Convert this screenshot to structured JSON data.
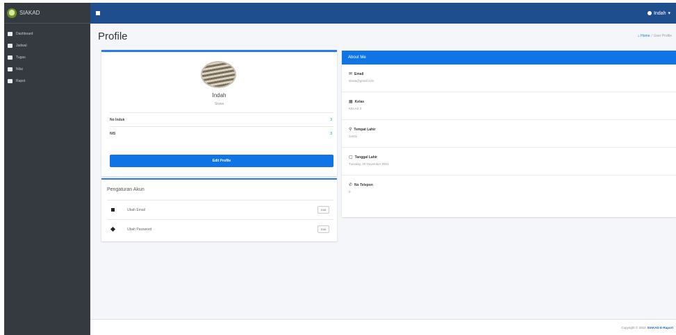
{
  "brand": {
    "title": "SIAKAD",
    "logo_icon": "school-logo-icon"
  },
  "sidebar": {
    "items": [
      {
        "label": "Dashboard",
        "icon": "home-icon"
      },
      {
        "label": "Jadwal",
        "icon": "calendar-icon"
      },
      {
        "label": "Tugas",
        "icon": "tasks-icon"
      },
      {
        "label": "Nilai",
        "icon": "book-icon"
      },
      {
        "label": "Rapot",
        "icon": "report-icon"
      }
    ]
  },
  "topbar": {
    "user_name": "Indah"
  },
  "header": {
    "page_title": "Profile",
    "breadcrumb_home": "Home",
    "breadcrumb_current": "User Profile"
  },
  "profile": {
    "name": "Indah",
    "role": "Siswa",
    "rows": [
      {
        "label": "No Induk",
        "value": "3"
      },
      {
        "label": "NIS",
        "value": "3"
      }
    ],
    "edit_button": "Edit Profile"
  },
  "settings": {
    "title": "Pengaturan Akun",
    "items": [
      {
        "label": "Ubah Email",
        "action": "Edit",
        "icon": "envelope-icon"
      },
      {
        "label": "Ubah Password",
        "action": "Edit",
        "icon": "key-icon"
      }
    ]
  },
  "about": {
    "title": "About Me",
    "items": [
      {
        "label": "Email",
        "value": "siswa@gmail.com",
        "icon": "envelope-icon",
        "glyph": "✉"
      },
      {
        "label": "Kelas",
        "value": "KELAS 3",
        "icon": "grid-icon",
        "glyph": "▦"
      },
      {
        "label": "Tempat Lahir",
        "value": "Jambi",
        "icon": "map-marker-icon",
        "glyph": "⚲"
      },
      {
        "label": "Tanggal Lahir",
        "value": "Tuesday, 20 November 2001",
        "icon": "calendar-icon",
        "glyph": "▢"
      },
      {
        "label": "No Telepon",
        "value": "0",
        "icon": "phone-icon",
        "glyph": "✆"
      }
    ]
  },
  "footer": {
    "text": "Copyright © 2022",
    "brand": "SIAKAD E-Raport"
  },
  "colors": {
    "sidebar": "#343a40",
    "topbar": "#1f4e8f",
    "primary": "#0f74e5"
  }
}
